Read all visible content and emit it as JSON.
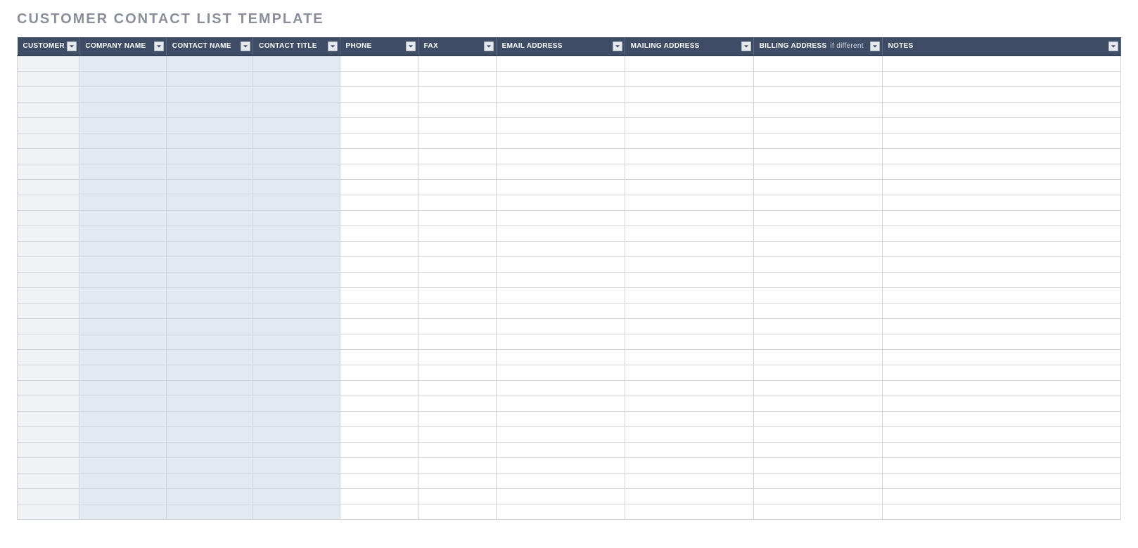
{
  "title": "CUSTOMER CONTACT LIST TEMPLATE",
  "columns": [
    {
      "label": "CUSTOMER ID",
      "suffix": "",
      "shade": "grey"
    },
    {
      "label": "COMPANY NAME",
      "suffix": "",
      "shade": "blue"
    },
    {
      "label": "CONTACT NAME",
      "suffix": "",
      "shade": "blue"
    },
    {
      "label": "CONTACT TITLE",
      "suffix": "",
      "shade": "blue"
    },
    {
      "label": "PHONE",
      "suffix": "",
      "shade": "white"
    },
    {
      "label": "FAX",
      "suffix": "",
      "shade": "white"
    },
    {
      "label": "EMAIL ADDRESS",
      "suffix": "",
      "shade": "white"
    },
    {
      "label": "MAILING ADDRESS",
      "suffix": "",
      "shade": "white"
    },
    {
      "label": "BILLING ADDRESS",
      "suffix": "if different",
      "shade": "white"
    },
    {
      "label": "NOTES",
      "suffix": "",
      "shade": "white"
    }
  ],
  "row_count": 30,
  "rows": [
    [
      "",
      "",
      "",
      "",
      "",
      "",
      "",
      "",
      "",
      ""
    ],
    [
      "",
      "",
      "",
      "",
      "",
      "",
      "",
      "",
      "",
      ""
    ],
    [
      "",
      "",
      "",
      "",
      "",
      "",
      "",
      "",
      "",
      ""
    ],
    [
      "",
      "",
      "",
      "",
      "",
      "",
      "",
      "",
      "",
      ""
    ],
    [
      "",
      "",
      "",
      "",
      "",
      "",
      "",
      "",
      "",
      ""
    ],
    [
      "",
      "",
      "",
      "",
      "",
      "",
      "",
      "",
      "",
      ""
    ],
    [
      "",
      "",
      "",
      "",
      "",
      "",
      "",
      "",
      "",
      ""
    ],
    [
      "",
      "",
      "",
      "",
      "",
      "",
      "",
      "",
      "",
      ""
    ],
    [
      "",
      "",
      "",
      "",
      "",
      "",
      "",
      "",
      "",
      ""
    ],
    [
      "",
      "",
      "",
      "",
      "",
      "",
      "",
      "",
      "",
      ""
    ],
    [
      "",
      "",
      "",
      "",
      "",
      "",
      "",
      "",
      "",
      ""
    ],
    [
      "",
      "",
      "",
      "",
      "",
      "",
      "",
      "",
      "",
      ""
    ],
    [
      "",
      "",
      "",
      "",
      "",
      "",
      "",
      "",
      "",
      ""
    ],
    [
      "",
      "",
      "",
      "",
      "",
      "",
      "",
      "",
      "",
      ""
    ],
    [
      "",
      "",
      "",
      "",
      "",
      "",
      "",
      "",
      "",
      ""
    ],
    [
      "",
      "",
      "",
      "",
      "",
      "",
      "",
      "",
      "",
      ""
    ],
    [
      "",
      "",
      "",
      "",
      "",
      "",
      "",
      "",
      "",
      ""
    ],
    [
      "",
      "",
      "",
      "",
      "",
      "",
      "",
      "",
      "",
      ""
    ],
    [
      "",
      "",
      "",
      "",
      "",
      "",
      "",
      "",
      "",
      ""
    ],
    [
      "",
      "",
      "",
      "",
      "",
      "",
      "",
      "",
      "",
      ""
    ],
    [
      "",
      "",
      "",
      "",
      "",
      "",
      "",
      "",
      "",
      ""
    ],
    [
      "",
      "",
      "",
      "",
      "",
      "",
      "",
      "",
      "",
      ""
    ],
    [
      "",
      "",
      "",
      "",
      "",
      "",
      "",
      "",
      "",
      ""
    ],
    [
      "",
      "",
      "",
      "",
      "",
      "",
      "",
      "",
      "",
      ""
    ],
    [
      "",
      "",
      "",
      "",
      "",
      "",
      "",
      "",
      "",
      ""
    ],
    [
      "",
      "",
      "",
      "",
      "",
      "",
      "",
      "",
      "",
      ""
    ],
    [
      "",
      "",
      "",
      "",
      "",
      "",
      "",
      "",
      "",
      ""
    ],
    [
      "",
      "",
      "",
      "",
      "",
      "",
      "",
      "",
      "",
      ""
    ],
    [
      "",
      "",
      "",
      "",
      "",
      "",
      "",
      "",
      "",
      ""
    ],
    [
      "",
      "",
      "",
      "",
      "",
      "",
      "",
      "",
      "",
      ""
    ]
  ]
}
